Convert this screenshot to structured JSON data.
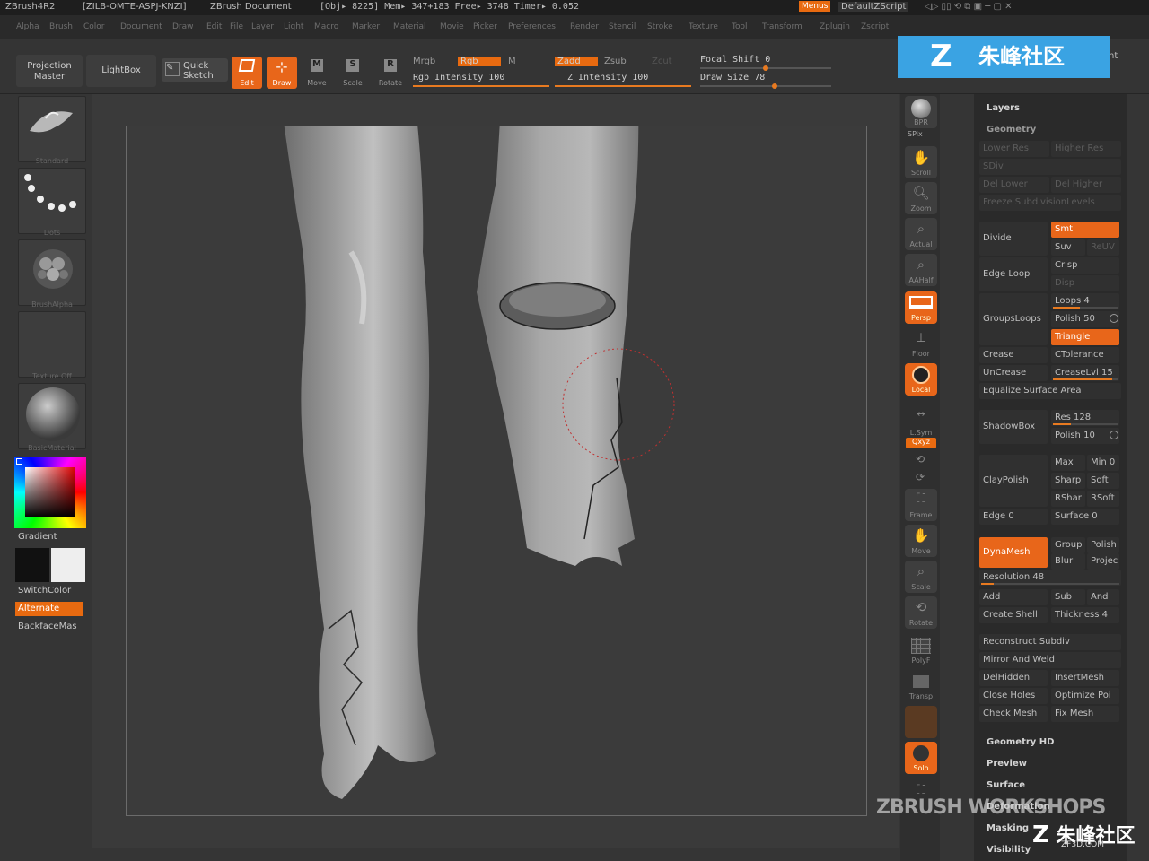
{
  "titlebar": {
    "app": "ZBrush4R2",
    "serial": "[ZILB-OMTE-ASPJ-KNZI]",
    "doc": "ZBrush Document",
    "stats": "[Obj▸ 8225] Mem▸ 347+183  Free▸ 3748  Timer▸ 0.052",
    "menus_btn": "Menus",
    "script": "DefaultZScript"
  },
  "menubar": {
    "items": [
      "Alpha",
      "Brush",
      "Color",
      "Document",
      "Draw",
      "Edit",
      "File",
      "Layer",
      "Light",
      "Macro",
      "Marker",
      "Material",
      "Movie",
      "Picker",
      "Preferences",
      "Render",
      "Stencil",
      "Stroke",
      "Texture",
      "Tool",
      "Transform",
      "Zplugin",
      "Zscript"
    ]
  },
  "toolbar": {
    "projection_master": "Projection Master",
    "lightbox": "LightBox",
    "quick_sketch": "Quick Sketch",
    "edit": "Edit",
    "draw": "Draw",
    "move": "Move",
    "scale": "Scale",
    "rotate": "Rotate",
    "mrgb": "Mrgb",
    "rgb": "Rgb",
    "m": "M",
    "rgb_intensity": "Rgb Intensity 100",
    "rgb_intensity_value": 100,
    "zadd": "Zadd",
    "zsub": "Zsub",
    "zcut": "Zcut",
    "z_intensity": "Z Intensity 100",
    "z_intensity_value": 100,
    "focal_shift": "Focal Shift 0",
    "draw_size": "Draw Size 78",
    "accent": "#e8661a"
  },
  "leftshelf": {
    "brush_label": "Standard",
    "stroke_label": "Dots",
    "alpha_label": "BrushAlpha",
    "texture_label": "Texture Off",
    "material_label": "BasicMaterial",
    "gradient": "Gradient",
    "switchcolor": "SwitchColor",
    "alternate": "Alternate",
    "backface": "BackfaceMas"
  },
  "rightshelf": {
    "bpr": "BPR",
    "spix": "SPix",
    "scroll": "Scroll",
    "zoom": "Zoom",
    "actual": "Actual",
    "aahalf": "AAHalf",
    "persp": "Persp",
    "floor": "Floor",
    "local": "Local",
    "lsym": "L.Sym",
    "xyz": "Qxyz",
    "frame": "Frame",
    "move": "Move",
    "scale": "Scale",
    "rotate": "Rotate",
    "polyf": "PolyF",
    "transp": "Transp",
    "solo": "Solo"
  },
  "palette": {
    "top_partial": "nt",
    "layers": "Layers",
    "geometry": "Geometry",
    "dim_rows": [
      "Lower Res",
      "Higher Res",
      "SDiv",
      "Del Lower",
      "Del Higher",
      "Freeze SubdivisionLevels"
    ],
    "divide": "Divide",
    "smt": "Smt",
    "suv": "Suv",
    "reuv": "ReUV",
    "edge_loop": "Edge Loop",
    "crisp": "Crisp",
    "disp": "Disp",
    "groupsloops": "GroupsLoops",
    "loops": "Loops 4",
    "polish": "Polish 50",
    "triangle": "Triangle",
    "crease": "Crease",
    "ctolerance": "CTolerance",
    "uncrease": "UnCrease",
    "creaselvl": "CreaseLvl 15",
    "equalize": "Equalize Surface Area",
    "shadowbox": "ShadowBox",
    "res": "Res 128",
    "polish10": "Polish 10",
    "claypolish": "ClayPolish",
    "max": "Max",
    "min": "Min 0",
    "sharp": "Sharp",
    "soft": "Soft",
    "rshar": "RShar",
    "rsoft": "RSoft",
    "edge0": "Edge 0",
    "surface0": "Surface 0",
    "dynamesh": "DynaMesh",
    "group": "Group",
    "polish_b": "Polish",
    "blur": "Blur",
    "project": "Projec",
    "resolution": "Resolution 48",
    "add": "Add",
    "sub": "Sub",
    "and": "And",
    "create_shell": "Create Shell",
    "thickness": "Thickness 4",
    "reconstruct": "Reconstruct Subdiv",
    "mirror_weld": "Mirror And Weld",
    "delhidden": "DelHidden",
    "insertmesh": "InsertMesh",
    "close_holes": "Close Holes",
    "optimize": "Optimize Poi",
    "check_mesh": "Check Mesh",
    "fix_mesh": "Fix Mesh",
    "geometry_hd": "Geometry HD",
    "preview": "Preview",
    "surface": "Surface",
    "deformation": "Deformation",
    "masking": "Masking",
    "visibility": "Visibility"
  },
  "watermarks": {
    "top": "朱峰社区",
    "workshops": "ZBRUSH WORKSHOPS",
    "bottom": "朱峰社区",
    "bottom_url": "ZF3D.COM"
  }
}
